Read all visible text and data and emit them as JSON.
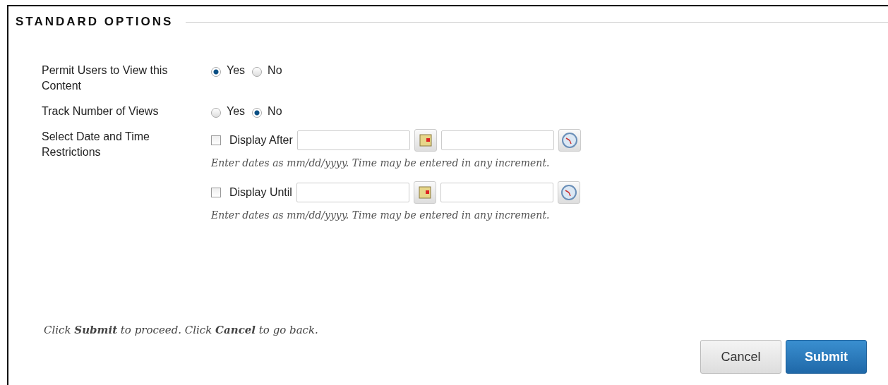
{
  "section": {
    "title": "STANDARD OPTIONS"
  },
  "radio_rows": [
    {
      "label": "Permit Users to View this Content",
      "options": [
        {
          "label": "Yes",
          "selected": true
        },
        {
          "label": "No",
          "selected": false
        }
      ]
    },
    {
      "label": "Track Number of Views",
      "options": [
        {
          "label": "Yes",
          "selected": false
        },
        {
          "label": "No",
          "selected": true
        }
      ]
    }
  ],
  "date_restrictions": {
    "label": "Select Date and Time Restrictions",
    "entries": [
      {
        "label": "Display After",
        "checked": false,
        "hint": "Enter dates as mm/dd/yyyy. Time may be entered in any increment."
      },
      {
        "label": "Display Until",
        "checked": false,
        "hint": "Enter dates as mm/dd/yyyy. Time may be entered in any increment."
      }
    ]
  },
  "footer": {
    "instructions": "Click **Submit** to proceed. Click **Cancel** to go back.",
    "buttons": [
      {
        "label": "Cancel",
        "kind": "secondary"
      },
      {
        "label": "Submit",
        "kind": "primary"
      }
    ]
  }
}
